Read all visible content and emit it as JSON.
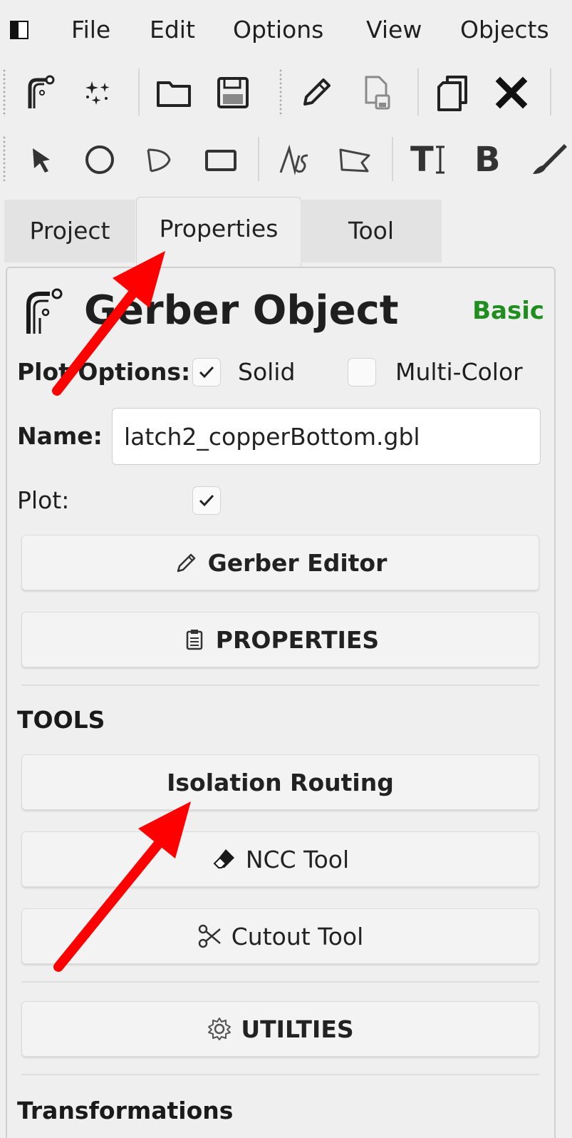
{
  "menu": [
    "File",
    "Edit",
    "Options",
    "View",
    "Objects"
  ],
  "toolbar": {
    "row1": [
      "new-gerber-icon",
      "new-geometry-icon",
      "open-folder-icon",
      "save-icon",
      "edit-pencil-icon",
      "save-as-icon",
      "copy-icon",
      "delete-icon"
    ],
    "row2": [
      "select-arrow-icon",
      "circle-icon",
      "arc-icon",
      "rectangle-icon",
      "path-icon",
      "polygon-icon",
      "text-icon",
      "bold-icon",
      "paint-icon"
    ],
    "text_tool": "T",
    "bold_tool": "B"
  },
  "tabs": [
    "Project",
    "Properties",
    "Tool"
  ],
  "active_tab": "Properties",
  "object": {
    "title": "Gerber Object",
    "level": "Basic",
    "plot_options_label": "Plot Options:",
    "solid_label": "Solid",
    "solid_checked": true,
    "multicolor_label": "Multi-Color",
    "multicolor_checked": false,
    "name_label": "Name:",
    "name_value": "latch2_copperBottom.gbl",
    "plot_label": "Plot:",
    "plot_checked": true
  },
  "buttons": {
    "gerber_editor": "Gerber Editor",
    "properties": "PROPERTIES",
    "isolation_routing": "Isolation Routing",
    "ncc_tool": "NCC Tool",
    "cutout_tool": "Cutout Tool",
    "utilities": "UTILTIES"
  },
  "sections": {
    "tools": "TOOLS",
    "transformations": "Transformations"
  },
  "colors": {
    "level_basic": "#1f8e1f",
    "annotation_arrow": "#ff0000"
  }
}
